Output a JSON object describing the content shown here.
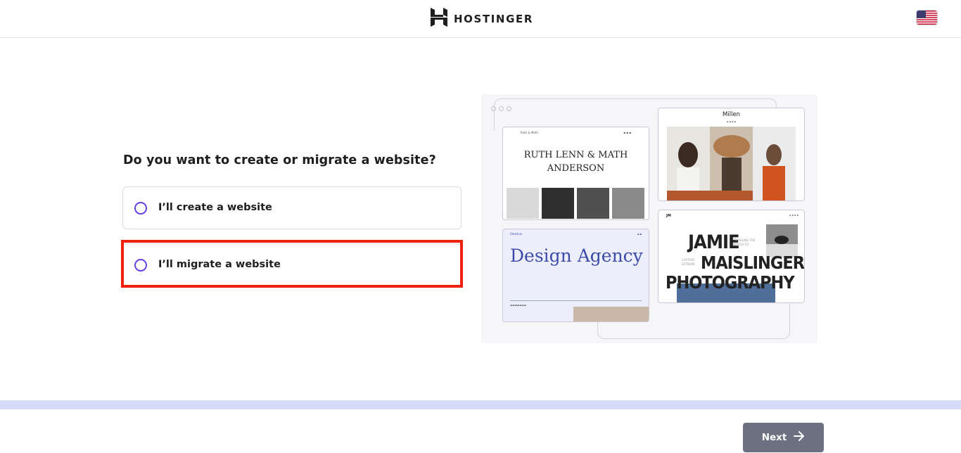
{
  "header": {
    "brand": "HOSTINGER",
    "logo_icon": "hostinger-h-logo",
    "language_icon": "us-flag-icon"
  },
  "main": {
    "question": "Do you want to create or migrate a website?",
    "options": [
      {
        "label": "I’ll create a website",
        "selected": false
      },
      {
        "label": "I’ll migrate a website",
        "selected": false,
        "highlighted": true
      }
    ],
    "highlight_color": "#f0200c",
    "radio_color": "#673de6"
  },
  "illustration": {
    "template_1": {
      "title": "RUTH LENN & MATH ANDERSON",
      "brand": "Ruth & Math"
    },
    "template_2": {
      "title": "Millen"
    },
    "template_3": {
      "title": "Design Agency",
      "brand": "Desica"
    },
    "template_4": {
      "line1": "JAMIE",
      "line2": "MAISLINGER",
      "line3": "PHOTOGRAPHY",
      "logo": "JM",
      "side1": "TRAVELING THE WORLD TO...",
      "side2": "CAPTURE EXTREME"
    }
  },
  "footer": {
    "next_label": "Next",
    "next_icon": "arrow-right-icon",
    "band_color": "#d6dbfa",
    "button_color": "#6d7081"
  }
}
